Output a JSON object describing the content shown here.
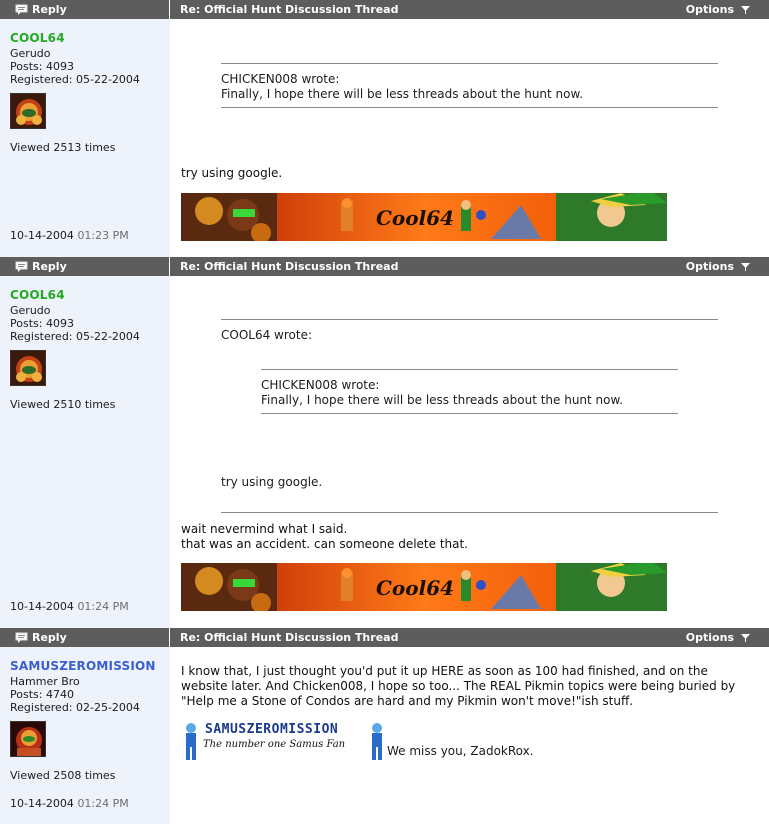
{
  "posts": [
    {
      "reply_label": "Reply",
      "title": "Re: Official Hunt Discussion Thread",
      "options_label": "Options",
      "username": "COOL64",
      "username_color": "#22aa22",
      "rank": "Gerudo",
      "posts_line": "Posts: 4093",
      "registered": "Registered: 05-22-2004",
      "views": "Viewed 2513 times",
      "date": "10-14-2004",
      "time": "01:23 PM",
      "quote": {
        "author": "CHICKEN008 wrote:",
        "text": "Finally, I hope there will be less threads about the hunt now."
      },
      "body": [
        "try using google."
      ],
      "signature_text": "Cool64"
    },
    {
      "reply_label": "Reply",
      "title": "Re: Official Hunt Discussion Thread",
      "options_label": "Options",
      "username": "COOL64",
      "username_color": "#22aa22",
      "rank": "Gerudo",
      "posts_line": "Posts: 4093",
      "registered": "Registered: 05-22-2004",
      "views": "Viewed 2510 times",
      "date": "10-14-2004",
      "time": "01:24 PM",
      "quote": {
        "author": "COOL64 wrote:",
        "nested_author": "CHICKEN008 wrote:",
        "nested_text": "Finally, I hope there will be less threads about the hunt now.",
        "text": "try using google."
      },
      "body": [
        "wait nevermind what I said.",
        "that was an accident. can someone delete that."
      ],
      "signature_text": "Cool64"
    },
    {
      "reply_label": "Reply",
      "title": "Re: Official Hunt Discussion Thread",
      "options_label": "Options",
      "username": "SAMUSZEROMISSION",
      "username_color": "#3a5fcd",
      "rank": "Hammer Bro",
      "posts_line": "Posts: 4740",
      "registered": "Registered: 02-25-2004",
      "views": "Viewed 2508 times",
      "date": "10-14-2004",
      "time": "01:24 PM",
      "body": [
        "I know that, I just thought you'd put it up HERE as soon as 100 had finished, and on the",
        "website later. And Chicken008, I hope so too... The REAL Pikmin topics were being buried by",
        "\"Help me a Stone of Condos are hard and my Pikmin won't move!\"ish stuff."
      ],
      "sig_title": "SAMUSZEROMISSION",
      "sig_sub": "The number one Samus Fan",
      "sig_after": "We miss you, ZadokRox."
    }
  ]
}
